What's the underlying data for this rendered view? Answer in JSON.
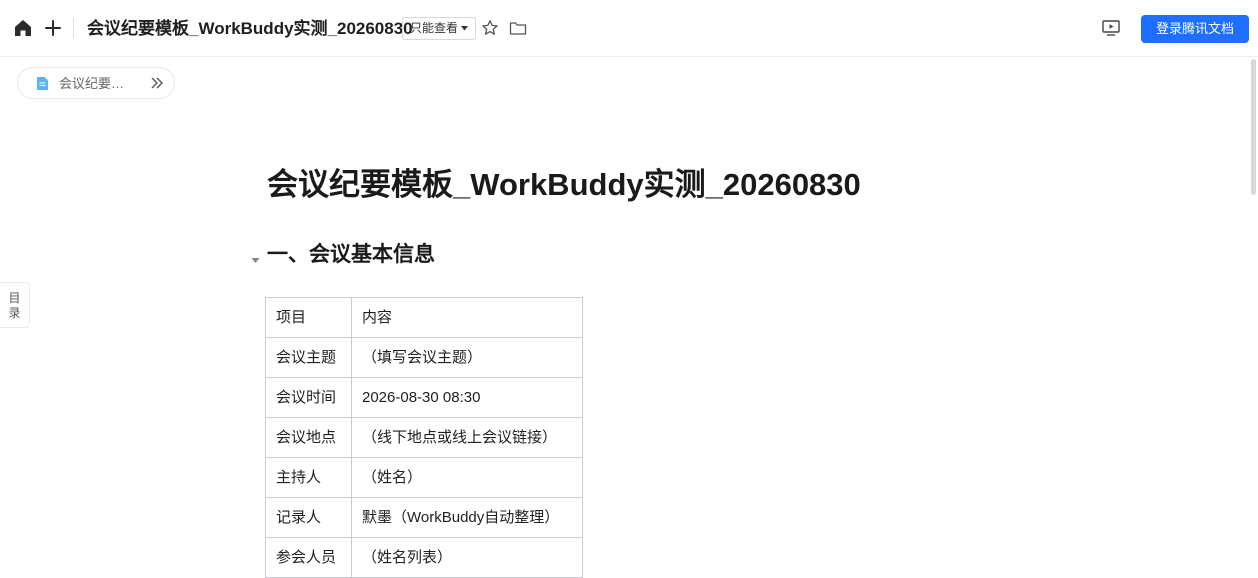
{
  "topbar": {
    "doc_title": "会议纪要模板_WorkBuddy实测_20260830",
    "permission_label": "只能查看",
    "login_label": "登录腾讯文档",
    "icons": [
      "home-icon",
      "plus-icon",
      "star-icon",
      "folder-icon",
      "present-icon"
    ]
  },
  "breadcrumb": {
    "label": "会议纪要…"
  },
  "toc_tab": {
    "line1": "目",
    "line2": "录"
  },
  "document": {
    "title": "会议纪要模板_WorkBuddy实测_20260830",
    "section1_heading": "一、会议基本信息",
    "table": {
      "rows": [
        [
          "项目",
          "内容"
        ],
        [
          "会议主题",
          "（填写会议主题）"
        ],
        [
          "会议时间",
          "2026-08-30 08:30"
        ],
        [
          "会议地点",
          "（线下地点或线上会议链接）"
        ],
        [
          "主持人",
          "（姓名）"
        ],
        [
          "记录人",
          "默墨（WorkBuddy自动整理）"
        ],
        [
          "参会人员",
          "（姓名列表）"
        ]
      ]
    }
  },
  "colors": {
    "accent": "#1e6fff",
    "border": "#c8ccd1",
    "doc_icon": "#5ab4f0"
  }
}
